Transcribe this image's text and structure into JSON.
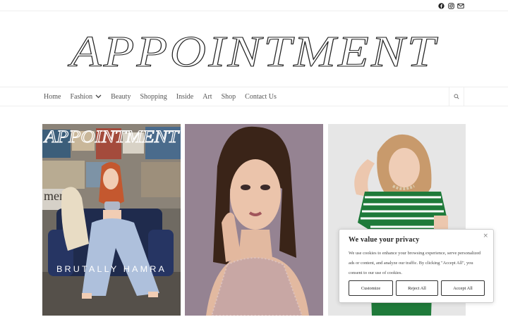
{
  "header": {
    "socials": [
      {
        "name": "facebook-icon"
      },
      {
        "name": "instagram-icon"
      },
      {
        "name": "mail-icon"
      }
    ]
  },
  "logo": {
    "text": "APPOINTMENT"
  },
  "nav": {
    "items": [
      {
        "label": "Home"
      },
      {
        "label": "Fashion",
        "has_dropdown": true
      },
      {
        "label": "Beauty"
      },
      {
        "label": "Shopping"
      },
      {
        "label": "Inside"
      },
      {
        "label": "Art"
      },
      {
        "label": "Shop"
      },
      {
        "label": "Contact Us"
      }
    ],
    "search_icon": "search-icon"
  },
  "cards": [
    {
      "cover_title": "APPOINTMENT",
      "cover_subtitle": "BRUTALLY HAMRA"
    },
    {},
    {}
  ],
  "cookie": {
    "title": "We value your privacy",
    "text": "We use cookies to enhance your browsing experience, serve personalized ads or content, and analyze our traffic. By clicking \"Accept All\", you consent to our use of cookies.",
    "close": "×",
    "customize": "Customize",
    "reject": "Reject All",
    "accept": "Accept All"
  },
  "colors": {
    "accent_green": "#1f7a3a",
    "text": "#333333",
    "border": "#eeeeee"
  }
}
